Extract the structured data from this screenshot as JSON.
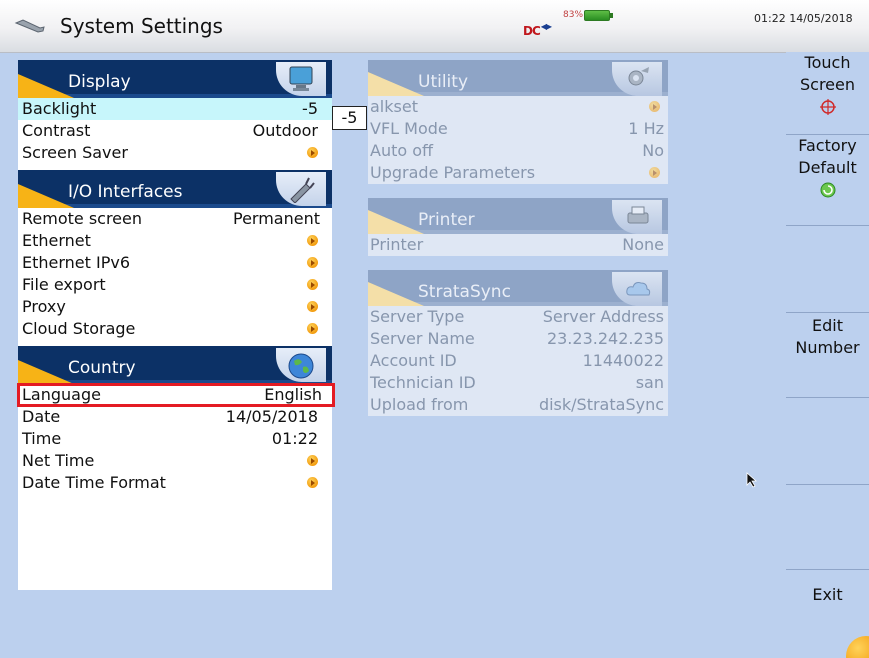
{
  "titlebar": {
    "title": "System Settings",
    "battery_pct": "83%",
    "clock": "01:22 14/05/2018",
    "dc_label": "DC"
  },
  "display": {
    "header": "Display",
    "rows": [
      {
        "label": "Backlight",
        "value": "-5"
      },
      {
        "label": "Contrast",
        "value": "Outdoor"
      },
      {
        "label": "Screen Saver",
        "value": ""
      }
    ],
    "edit_value": "-5"
  },
  "io": {
    "header": "I/O Interfaces",
    "rows": [
      {
        "label": "Remote screen",
        "value": "Permanent"
      },
      {
        "label": "Ethernet",
        "value": ""
      },
      {
        "label": "Ethernet IPv6",
        "value": ""
      },
      {
        "label": "File export",
        "value": ""
      },
      {
        "label": "Proxy",
        "value": ""
      },
      {
        "label": "Cloud Storage",
        "value": ""
      }
    ]
  },
  "country": {
    "header": "Country",
    "rows": [
      {
        "label": "Language",
        "value": "English"
      },
      {
        "label": "Date",
        "value": "14/05/2018"
      },
      {
        "label": "Time",
        "value": "01:22"
      },
      {
        "label": "Net Time",
        "value": ""
      },
      {
        "label": "Date Time Format",
        "value": ""
      }
    ]
  },
  "utility": {
    "header": "Utility",
    "rows": [
      {
        "label": "alkset",
        "value": ""
      },
      {
        "label": "VFL Mode",
        "value": "1 Hz"
      },
      {
        "label": "Auto off",
        "value": "No"
      },
      {
        "label": "Upgrade Parameters",
        "value": ""
      }
    ]
  },
  "printer": {
    "header": "Printer",
    "rows": [
      {
        "label": "Printer",
        "value": "None"
      }
    ]
  },
  "stratasync": {
    "header": "StrataSync",
    "rows": [
      {
        "label": "Server Type",
        "value": "Server Address"
      },
      {
        "label": "Server Name",
        "value": "23.23.242.235"
      },
      {
        "label": "Account ID",
        "value": "11440022"
      },
      {
        "label": "Technician ID",
        "value": "san"
      },
      {
        "label": "Upload from",
        "value": "disk/StrataSync"
      }
    ]
  },
  "fkeys": {
    "touch_screen_1": "Touch",
    "touch_screen_2": "Screen",
    "factory_default_1": "Factory",
    "factory_default_2": "Default",
    "edit_number_1": "Edit",
    "edit_number_2": "Number",
    "exit": "Exit"
  },
  "colors": {
    "accent": "#f7b316",
    "header_bg": "#0c3166",
    "selected_row": "#c7f6fb",
    "highlight_border": "#e41b23",
    "background": "#bcd0ee"
  }
}
